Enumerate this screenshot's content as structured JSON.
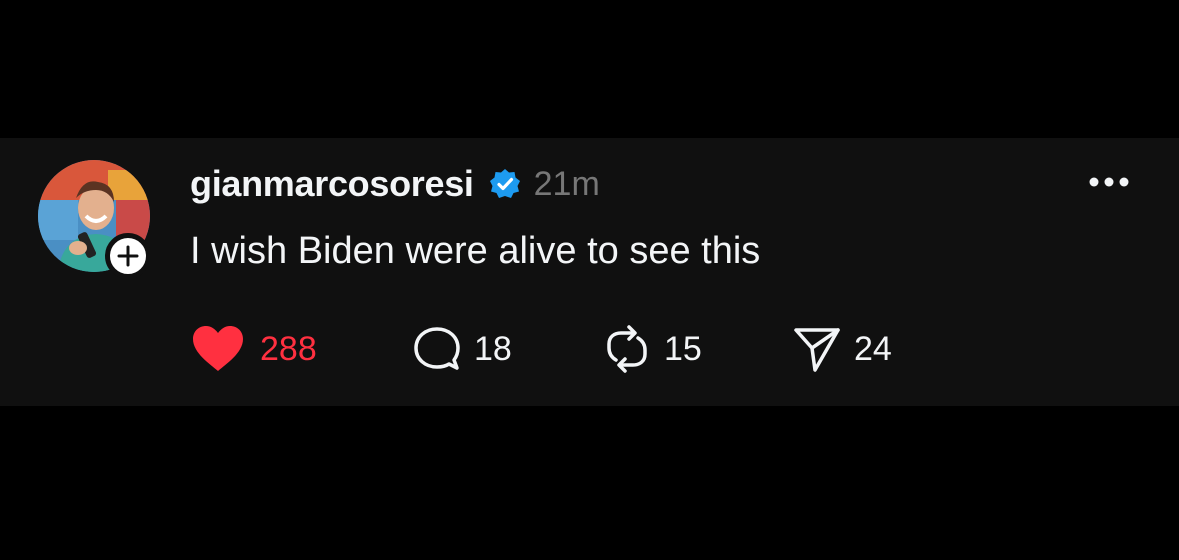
{
  "post": {
    "username": "gianmarcosoresi",
    "verified": true,
    "timestamp": "21m",
    "text": "I wish Biden were alive to see this",
    "avatar": "profile-photo",
    "actions": {
      "likes": "288",
      "replies": "18",
      "reposts": "15",
      "shares": "24",
      "liked": true
    }
  },
  "colors": {
    "background": "#000000",
    "card": "#101010",
    "text": "#f3f5f7",
    "muted": "#777777",
    "like": "#ff3040",
    "verified": "#1d9bf0"
  },
  "icons": [
    "plus-icon",
    "verified-badge-icon",
    "more-icon",
    "heart-icon",
    "comment-icon",
    "repost-icon",
    "share-icon"
  ]
}
